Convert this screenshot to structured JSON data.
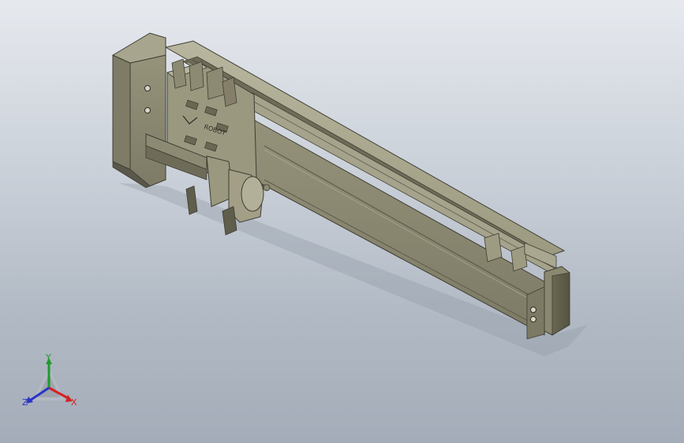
{
  "viewport": {
    "background_top": "#e6e9ee",
    "background_bottom": "#a3acb8"
  },
  "model": {
    "logo_text": "ROBOT",
    "body_color": "#8e8c74",
    "body_dark_color": "#5f5d4b",
    "body_light_color": "#b8b69e"
  },
  "triad": {
    "axes": [
      {
        "label": "Y",
        "color": "#1d9a2c"
      },
      {
        "label": "Z",
        "color": "#2a35c9"
      },
      {
        "label": "X",
        "color": "#d42222"
      }
    ]
  }
}
